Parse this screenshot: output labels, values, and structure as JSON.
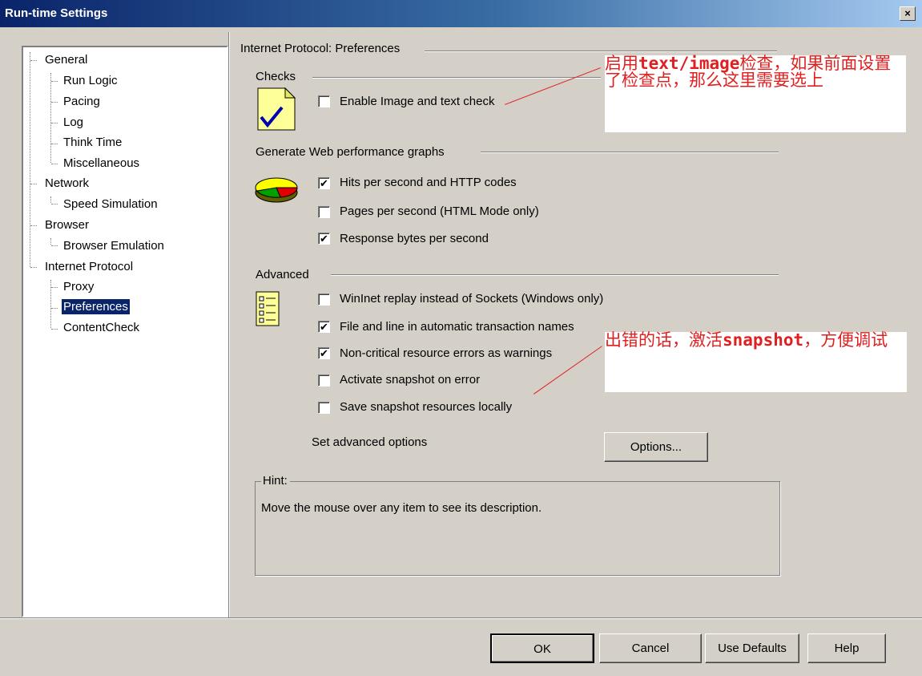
{
  "window": {
    "title": "Run-time Settings",
    "close_label": "×"
  },
  "tree": {
    "items": [
      {
        "label": "General"
      },
      {
        "label": "Run Logic"
      },
      {
        "label": "Pacing"
      },
      {
        "label": "Log"
      },
      {
        "label": "Think Time"
      },
      {
        "label": "Miscellaneous"
      },
      {
        "label": "Network"
      },
      {
        "label": "Speed Simulation"
      },
      {
        "label": "Browser"
      },
      {
        "label": "Browser Emulation"
      },
      {
        "label": "Internet Protocol"
      },
      {
        "label": "Proxy"
      },
      {
        "label": "Preferences"
      },
      {
        "label": "ContentCheck"
      }
    ],
    "selected": "Preferences"
  },
  "panel": {
    "heading": "Internet Protocol: Preferences",
    "checks": {
      "title": "Checks",
      "items": [
        {
          "label": "Enable Image and text check",
          "checked": false
        }
      ]
    },
    "graphs": {
      "title": "Generate Web performance graphs",
      "items": [
        {
          "label": "Hits per second and HTTP codes",
          "checked": true
        },
        {
          "label": "Pages per second (HTML Mode only)",
          "checked": false
        },
        {
          "label": "Response bytes per second",
          "checked": true
        }
      ]
    },
    "advanced": {
      "title": "Advanced",
      "items": [
        {
          "label": "WinInet replay instead of Sockets (Windows only)",
          "checked": false
        },
        {
          "label": "File and line in automatic transaction names",
          "checked": true
        },
        {
          "label": "Non-critical resource errors as warnings",
          "checked": true
        },
        {
          "label": "Activate snapshot on error",
          "checked": false
        },
        {
          "label": "Save snapshot resources locally",
          "checked": false
        }
      ],
      "options_label": "Set advanced options",
      "options_button": "Options..."
    },
    "hint": {
      "title": "Hint:",
      "text": "Move the mouse over any item to see its description."
    }
  },
  "annotations": {
    "top_pre": "启用",
    "top_code": "text/image",
    "top_post": "检查，如果前面设置了检查点，那么这里需要选上",
    "bottom_pre": "出错的话，激活",
    "bottom_code": "snapshot",
    "bottom_post": "，方便调试",
    "color": "#e02020"
  },
  "footer": {
    "ok": "OK",
    "cancel": "Cancel",
    "defaults": "Use Defaults",
    "help": "Help"
  }
}
